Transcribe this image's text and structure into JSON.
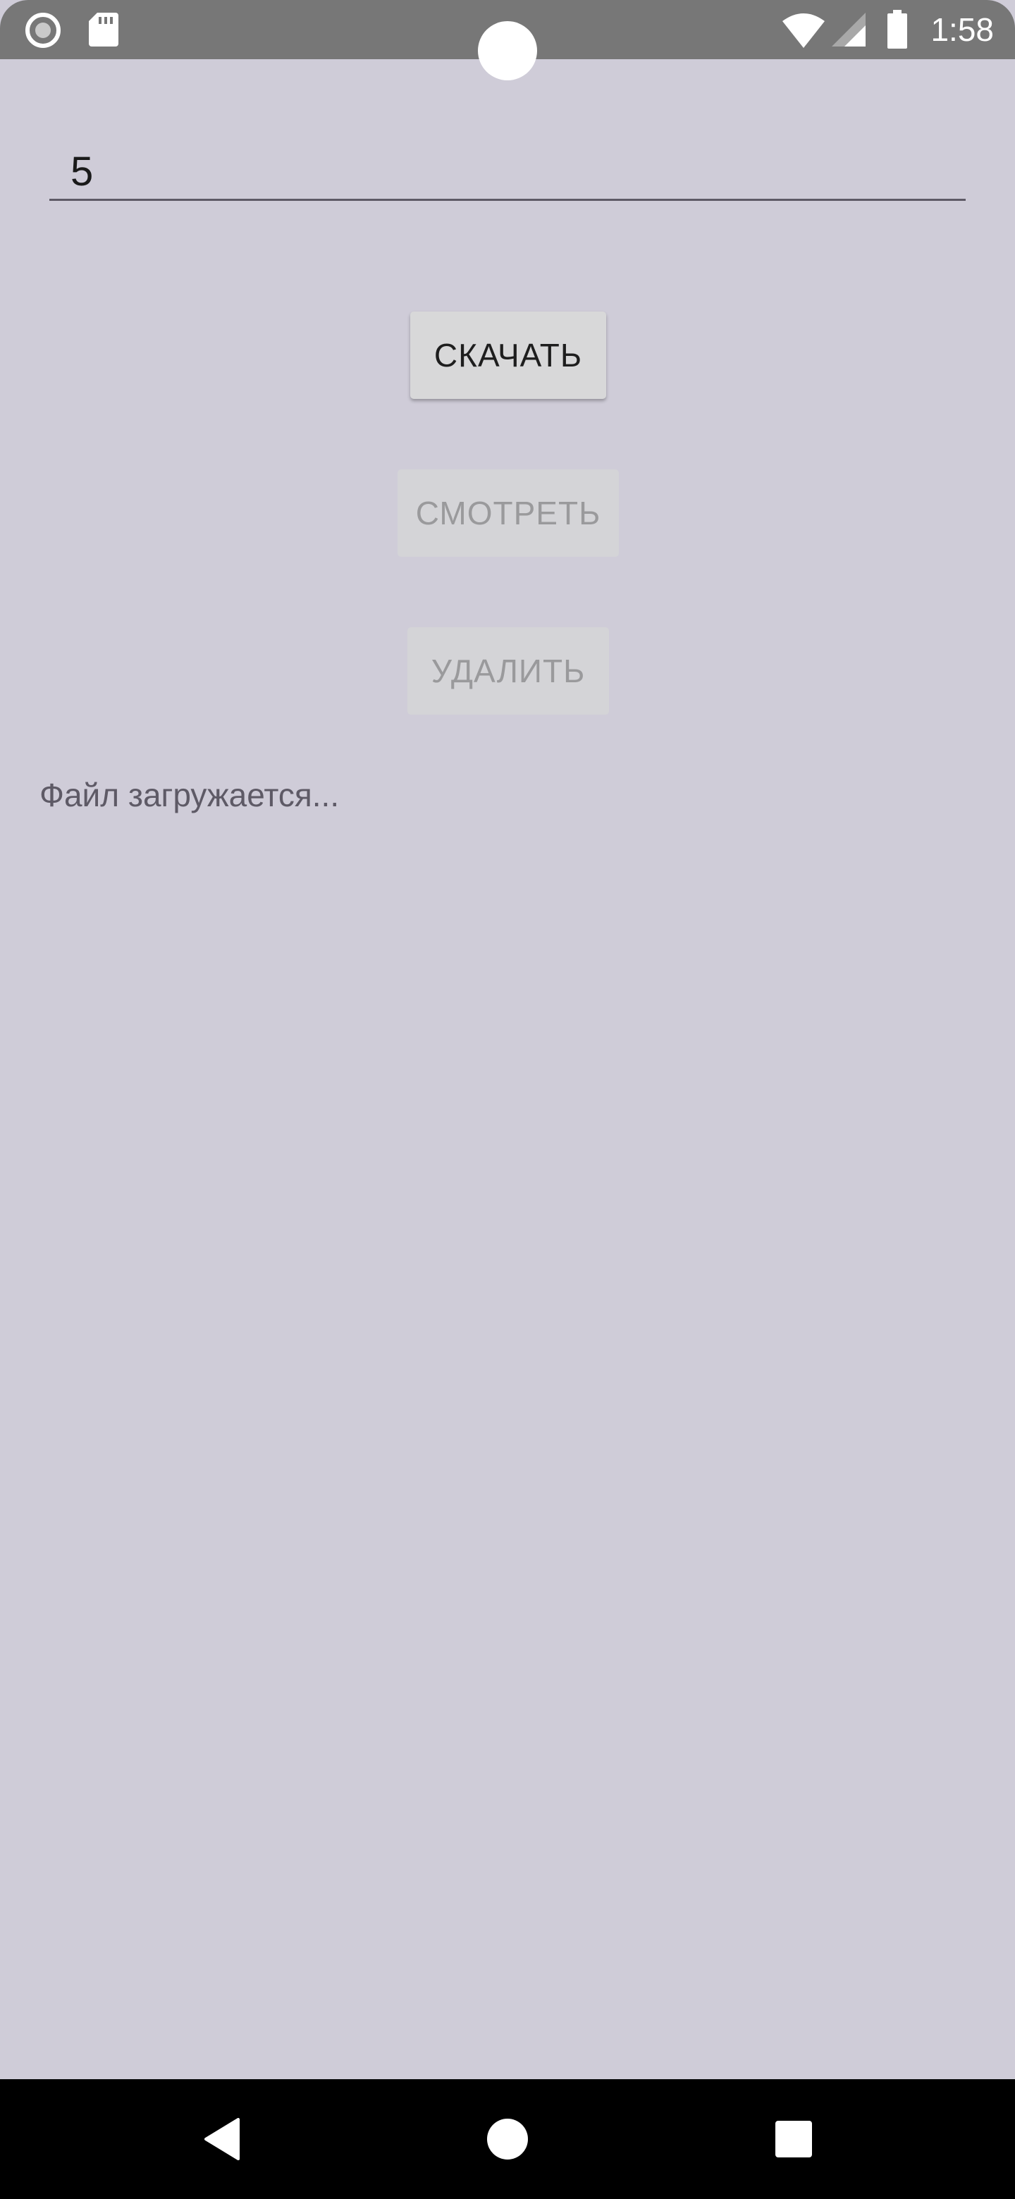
{
  "status_bar": {
    "time": "1:58",
    "icons": {
      "left": [
        "record-icon",
        "sd-card-icon"
      ],
      "right": [
        "wifi-icon",
        "cell-signal-icon",
        "battery-icon"
      ]
    }
  },
  "form": {
    "input_value": "5"
  },
  "buttons": {
    "download_label": "СКАЧАТЬ",
    "view_label": "СМОТРЕТЬ",
    "delete_label": "УДАЛИТЬ"
  },
  "status": {
    "message": "Файл загружается..."
  },
  "nav": {
    "icons": [
      "back-icon",
      "home-icon",
      "recents-icon"
    ]
  },
  "colors": {
    "background": "#cfccd8",
    "status_bar": "#777777",
    "nav_bar": "#000000",
    "button_enabled": "#d8d8d9",
    "button_disabled_text": "#9a9a9c"
  }
}
